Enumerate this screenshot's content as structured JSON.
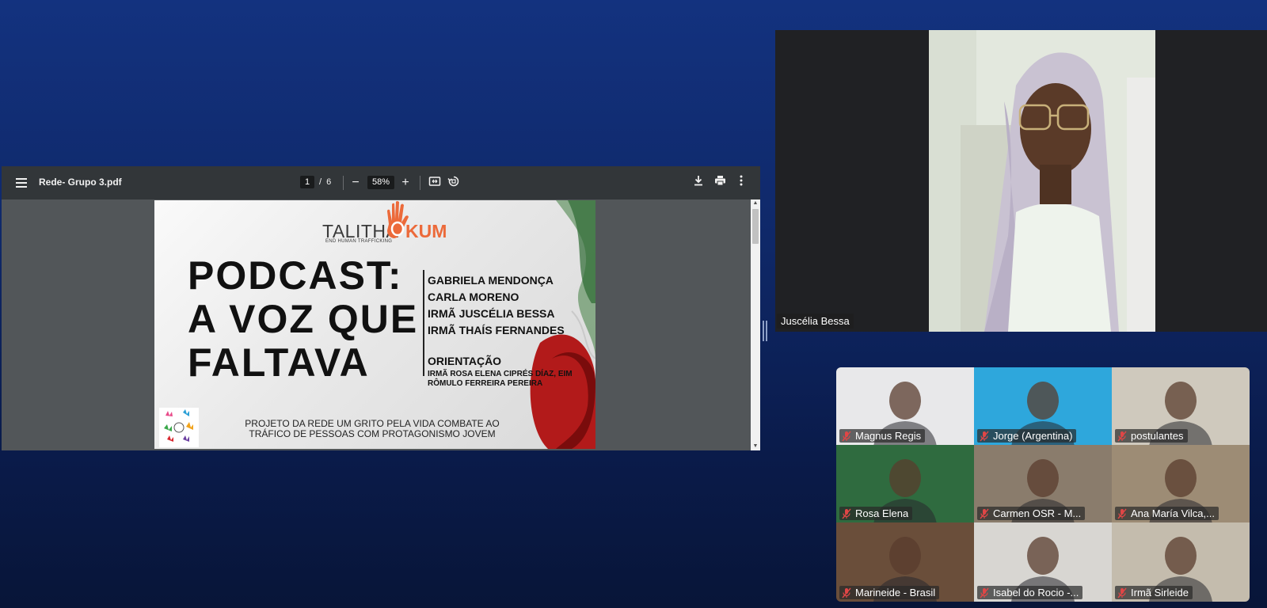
{
  "pdf_viewer": {
    "file_name": "Rede- Grupo 3.pdf",
    "current_page": "1",
    "page_separator": "/",
    "total_pages": "6",
    "zoom": "58%"
  },
  "slide": {
    "logo_word": "TALITHA",
    "logo_word_2": "KUM",
    "logo_tagline": "END HUMAN TRAFFICKING",
    "title_lines": [
      "PODCAST:",
      "A VOZ QUE",
      "FALTAVA"
    ],
    "names": [
      "GABRIELA MENDONÇA",
      "CARLA MORENO",
      "IRMÃ JUSCÉLIA BESSA",
      "IRMÃ THAÍS FERNANDES"
    ],
    "orientation_label": "ORIENTAÇÃO",
    "orientation_names": [
      "IRMÃ ROSA ELENA CIPRÉS DÍAZ, EIM",
      "RÔMULO FERREIRA PEREIRA"
    ],
    "footer_lines": [
      "PROJETO DA REDE UM GRITO PELA VIDA COMBATE AO",
      "TRÁFICO DE PESSOAS COM PROTAGONISMO JOVEM"
    ]
  },
  "speaker": {
    "name": "Juscélia Bessa"
  },
  "gallery": {
    "participants": [
      {
        "name": "Magnus Regis",
        "bg": "#e8e8ea",
        "muted": true
      },
      {
        "name": "Jorge (Argentina)",
        "bg": "#2ea7dc",
        "muted": true
      },
      {
        "name": "postulantes",
        "bg": "#cfc9bd",
        "muted": true
      },
      {
        "name": "Rosa Elena",
        "bg": "#2f6b3f",
        "muted": true
      },
      {
        "name": "Carmen OSR - M...",
        "bg": "#8a7c6c",
        "muted": true
      },
      {
        "name": "Ana María Vilca,...",
        "bg": "#9d8c75",
        "muted": true
      },
      {
        "name": "Marineide - Brasil",
        "bg": "#6a4e3a",
        "muted": true
      },
      {
        "name": "Isabel do Rocio  -...",
        "bg": "#d8d6d2",
        "muted": true
      },
      {
        "name": "Irmã Sirleide",
        "bg": "#c4bcad",
        "muted": true
      }
    ]
  }
}
